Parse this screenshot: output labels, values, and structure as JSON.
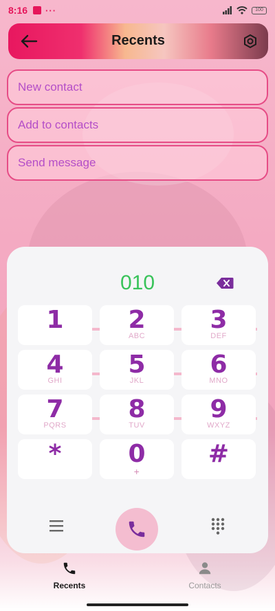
{
  "status_bar": {
    "time": "8:16",
    "battery": "100"
  },
  "header": {
    "title": "Recents"
  },
  "actions": [
    {
      "label": "New contact"
    },
    {
      "label": "Add to contacts"
    },
    {
      "label": "Send message"
    }
  ],
  "dialpad": {
    "number": "010",
    "number_color": "#39c35a",
    "keys": [
      {
        "digit": "1",
        "letters": ""
      },
      {
        "digit": "2",
        "letters": "ABC"
      },
      {
        "digit": "3",
        "letters": "DEF"
      },
      {
        "digit": "4",
        "letters": "GHI"
      },
      {
        "digit": "5",
        "letters": "JKL"
      },
      {
        "digit": "6",
        "letters": "MNO"
      },
      {
        "digit": "7",
        "letters": "PQRS"
      },
      {
        "digit": "8",
        "letters": "TUV"
      },
      {
        "digit": "9",
        "letters": "WXYZ"
      },
      {
        "digit": "*",
        "letters": ""
      },
      {
        "digit": "0",
        "letters": "+"
      },
      {
        "digit": "#",
        "letters": ""
      }
    ]
  },
  "nav": {
    "items": [
      {
        "label": "Recents",
        "icon": "phone-icon",
        "active": true
      },
      {
        "label": "Contacts",
        "icon": "person-icon",
        "active": false
      }
    ]
  },
  "colors": {
    "accent": "#e6155a",
    "digit": "#8e2ca6",
    "action_text": "#b44ec8",
    "action_border": "#e64c86"
  }
}
